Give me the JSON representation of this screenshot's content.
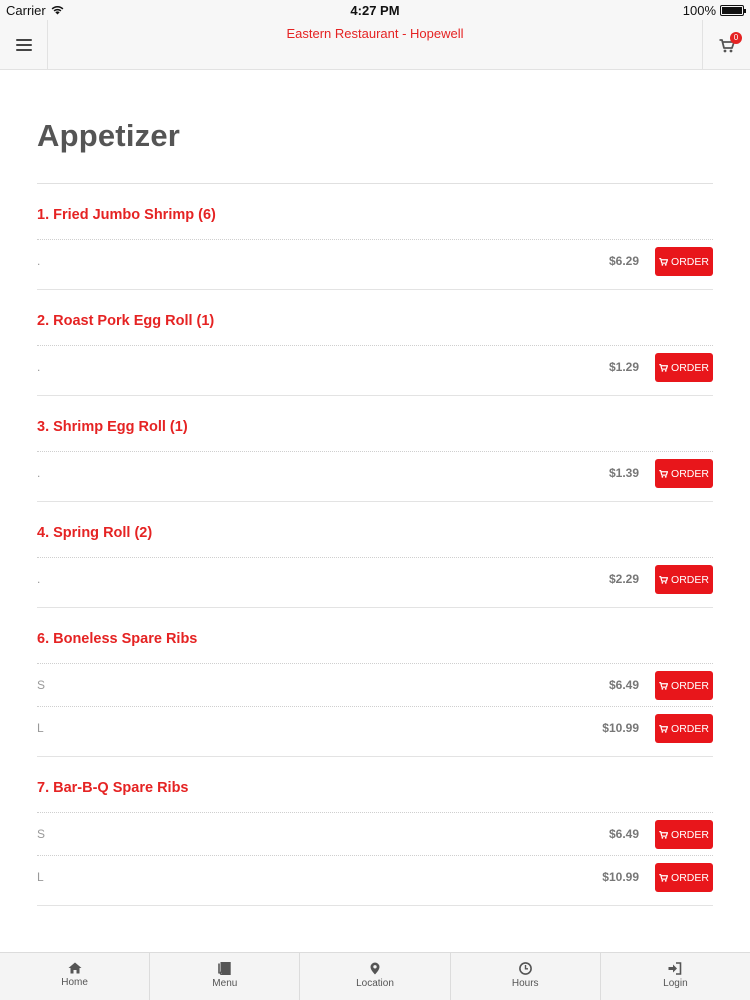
{
  "status_bar": {
    "carrier": "Carrier",
    "time": "4:27 PM",
    "battery": "100%"
  },
  "nav": {
    "title": "Eastern Restaurant - Hopewell",
    "cart_count": "0"
  },
  "section_title": "Appetizer",
  "order_label": "ORDER",
  "items": [
    {
      "name": "1. Fried Jumbo Shrimp (6)",
      "variants": [
        {
          "label": ".",
          "price": "$6.29"
        }
      ]
    },
    {
      "name": "2. Roast Pork Egg Roll (1)",
      "variants": [
        {
          "label": ".",
          "price": "$1.29"
        }
      ]
    },
    {
      "name": "3. Shrimp Egg Roll (1)",
      "variants": [
        {
          "label": ".",
          "price": "$1.39"
        }
      ]
    },
    {
      "name": "4. Spring Roll (2)",
      "variants": [
        {
          "label": ".",
          "price": "$2.29"
        }
      ]
    },
    {
      "name": "6. Boneless Spare Ribs",
      "variants": [
        {
          "label": "S",
          "price": "$6.49"
        },
        {
          "label": "L",
          "price": "$10.99"
        }
      ]
    },
    {
      "name": "7. Bar-B-Q Spare Ribs",
      "variants": [
        {
          "label": "S",
          "price": "$6.49"
        },
        {
          "label": "L",
          "price": "$10.99"
        }
      ]
    }
  ],
  "tabs": [
    {
      "label": "Home",
      "icon": "home-icon"
    },
    {
      "label": "Menu",
      "icon": "book-icon"
    },
    {
      "label": "Location",
      "icon": "map-marker-icon"
    },
    {
      "label": "Hours",
      "icon": "clock-icon"
    },
    {
      "label": "Login",
      "icon": "sign-in-icon"
    }
  ]
}
